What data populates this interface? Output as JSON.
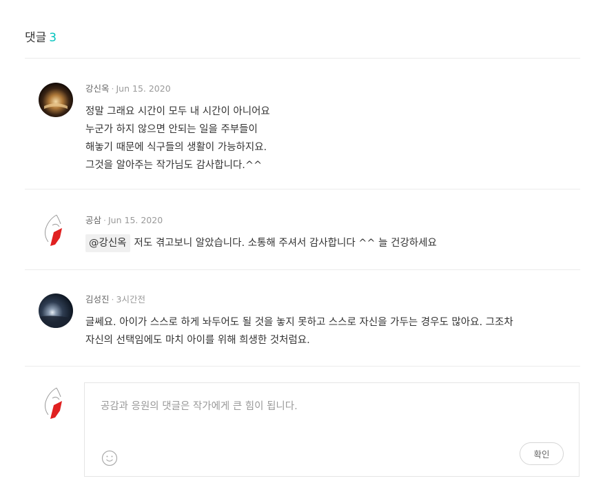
{
  "header": {
    "title": "댓글",
    "count": "3"
  },
  "comments": [
    {
      "author": "강신옥",
      "date": "Jun 15. 2020",
      "lines": [
        "정말 그래요 시간이 모두 내 시간이 아니어요",
        "누군가 하지 않으면 안되는 일을 주부들이",
        "해놓기 때문에 식구들의 생활이 가능하지요.",
        "그것을 알아주는 작가님도 감사합니다.^^"
      ]
    },
    {
      "author": "공삼",
      "date": "Jun 15. 2020",
      "mention": "@강신옥",
      "text": "저도 겪고보니 알았습니다. 소통해 주셔서 감사합니다 ^^ 늘 건강하세요"
    },
    {
      "author": "김성진",
      "date": "3시간전",
      "lines": [
        "글쎄요. 아이가 스스로 하게 놔두어도 될 것을 놓지 못하고 스스로 자신을 가두는 경우도 많아요. 그조차",
        "자신의 선택임에도 마치 아이를 위해 희생한 것처럼요."
      ]
    }
  ],
  "composer": {
    "placeholder": "공감과 응원의 댓글은 작가에게 큰 힘이 됩니다.",
    "submit_label": "확인",
    "emoji_icon": "smiley-icon"
  },
  "colors": {
    "accent": "#00c3bd",
    "divider": "#ebebeb"
  }
}
